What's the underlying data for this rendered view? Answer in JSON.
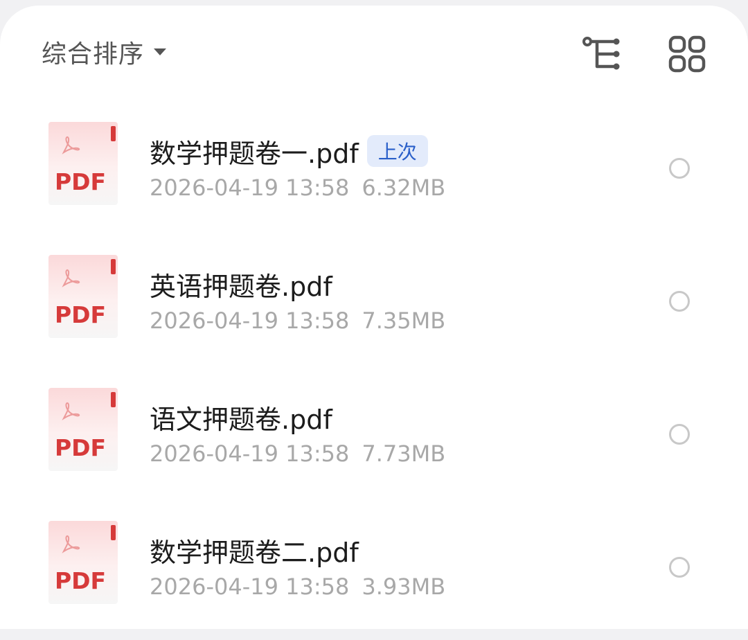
{
  "toolbar": {
    "sort_label": "综合排序",
    "sort_caret_icon": "caret-down-icon",
    "tree_view_icon": "tree-view-icon",
    "grid_view_icon": "grid-view-icon"
  },
  "pdf_icon": {
    "label": "PDF",
    "brand_color": "#d63a3a"
  },
  "files": [
    {
      "name": "数学押题卷一.pdf",
      "badge": "上次",
      "date": "2026-04-19 13:58",
      "size": "6.32MB"
    },
    {
      "name": "英语押题卷.pdf",
      "badge": "",
      "date": "2026-04-19 13:58",
      "size": "7.35MB"
    },
    {
      "name": "语文押题卷.pdf",
      "badge": "",
      "date": "2026-04-19 13:58",
      "size": "7.73MB"
    },
    {
      "name": "数学押题卷二.pdf",
      "badge": "",
      "date": "2026-04-19 13:58",
      "size": "3.93MB"
    }
  ],
  "colors": {
    "badge_bg": "#e3ebfb",
    "badge_text": "#2a5fc9",
    "meta_text": "#a8a8a8"
  }
}
